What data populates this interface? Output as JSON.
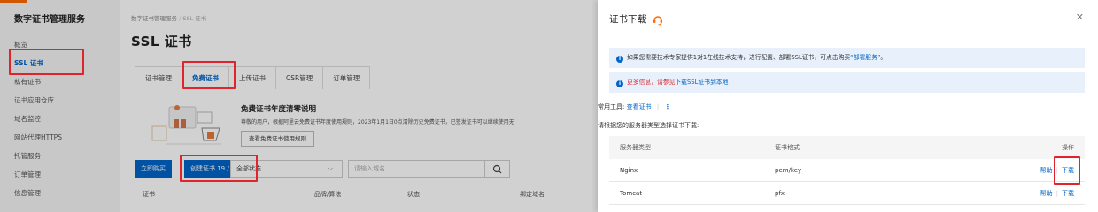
{
  "sidebar": {
    "title": "数字证书管理服务",
    "items": [
      "概览",
      "SSL 证书",
      "私有证书",
      "证书应用仓库",
      "域名监控",
      "网站代理HTTPS",
      "托管服务",
      "订单管理",
      "信息管理"
    ]
  },
  "main": {
    "breadcrumb": [
      "数字证书管理服务",
      "SSL 证书"
    ],
    "title": "SSL 证书",
    "tabs": [
      "证书管理",
      "免费证书",
      "上传证书",
      "CSR管理",
      "订单管理"
    ],
    "active_tab": "免费证书",
    "notice": {
      "title": "免费证书年度清零说明",
      "text": "尊敬的用户，根据阿里云免费证书年度使用规则，2023年1月1日0点清除历史免费证书，已签发证书可以继续使用无",
      "button": "查看免费证书使用规则"
    },
    "buy_button": "立即购买",
    "create_button": "创建证书 19 / 20",
    "status_select": "全部状态",
    "search_placeholder": "请输入域名",
    "columns": [
      "证书",
      "品牌/算法",
      "状态",
      "绑定域名"
    ]
  },
  "drawer": {
    "title": "证书下载",
    "info1_prefix": "如果您需要技术专家提供1对1在线技术支持，进行配置、部署SSL证书，可点击购买",
    "info1_link": "部署服务",
    "info1_suffix": "。",
    "info2_prefix": "更多信息，请参见",
    "info2_link": "下载SSL证书到本地",
    "tools_label": "常用工具:",
    "tools_link": "查看证书",
    "choose_text": "请根据您的服务器类型选择证书下载:",
    "table": {
      "headers": [
        "服务器类型",
        "证书格式",
        "操作"
      ],
      "rows": [
        {
          "server": "Nginx",
          "format": "pem/key",
          "help": "帮助",
          "download": "下载"
        },
        {
          "server": "Tomcat",
          "format": "pfx",
          "help": "帮助",
          "download": "下载"
        }
      ]
    }
  },
  "colors": {
    "accent": "#0064c8",
    "highlight": "#e0242e",
    "brand": "#ff6a00"
  }
}
